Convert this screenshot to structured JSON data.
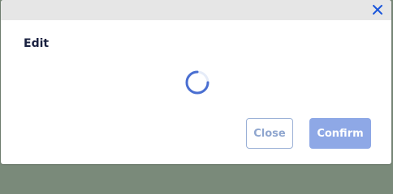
{
  "dialog": {
    "title": "Edit",
    "close_icon": "close-icon",
    "loading_icon": "spinner-icon",
    "buttons": {
      "close_label": "Close",
      "confirm_label": "Confirm"
    }
  },
  "colors": {
    "accent": "#1a56db",
    "confirm_bg_disabled": "#8ea8e6",
    "close_border": "#9ab0d6",
    "title_text": "#1a2140",
    "titlebar_bg": "#e6e6e6"
  }
}
